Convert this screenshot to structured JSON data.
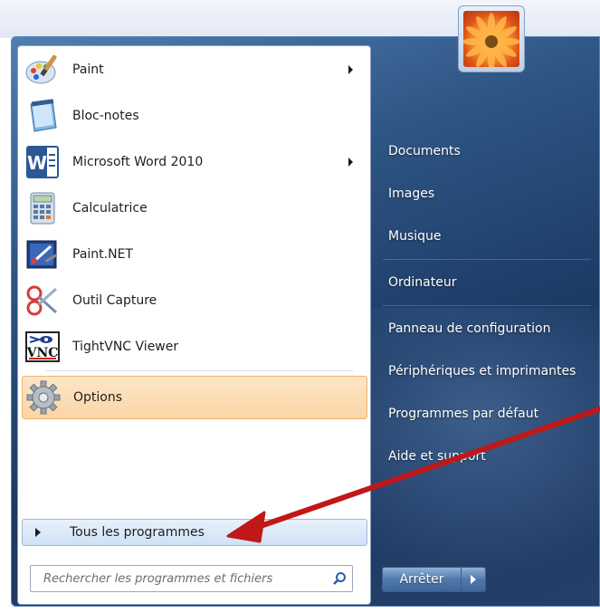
{
  "programs": [
    {
      "label": "Paint",
      "icon": "paint-icon",
      "has_submenu": true
    },
    {
      "label": "Bloc-notes",
      "icon": "notepad-icon",
      "has_submenu": false
    },
    {
      "label": "Microsoft Word 2010",
      "icon": "word-icon",
      "has_submenu": true
    },
    {
      "label": "Calculatrice",
      "icon": "calculator-icon",
      "has_submenu": false
    },
    {
      "label": "Paint.NET",
      "icon": "paintnet-icon",
      "has_submenu": false
    },
    {
      "label": "Outil Capture",
      "icon": "snipping-tool-icon",
      "has_submenu": false
    },
    {
      "label": "TightVNC Viewer",
      "icon": "tightvnc-icon",
      "has_submenu": false
    }
  ],
  "options_item": {
    "label": "Options",
    "icon": "gear-icon",
    "highlighted": true
  },
  "all_programs": {
    "label": "Tous les programmes"
  },
  "search": {
    "placeholder": "Rechercher les programmes et fichiers",
    "value": ""
  },
  "right_pane": [
    {
      "label": "Documents"
    },
    {
      "label": "Images"
    },
    {
      "label": "Musique"
    },
    {
      "label": "Ordinateur"
    },
    {
      "label": "Panneau de configuration"
    },
    {
      "label": "Périphériques et imprimantes"
    },
    {
      "label": "Programmes par défaut"
    },
    {
      "label": "Aide et support"
    }
  ],
  "shutdown": {
    "label": "Arrêter"
  },
  "colors": {
    "highlight": "#fbd5a6",
    "annotation_arrow": "#c01818",
    "glass": "#2e5584"
  }
}
